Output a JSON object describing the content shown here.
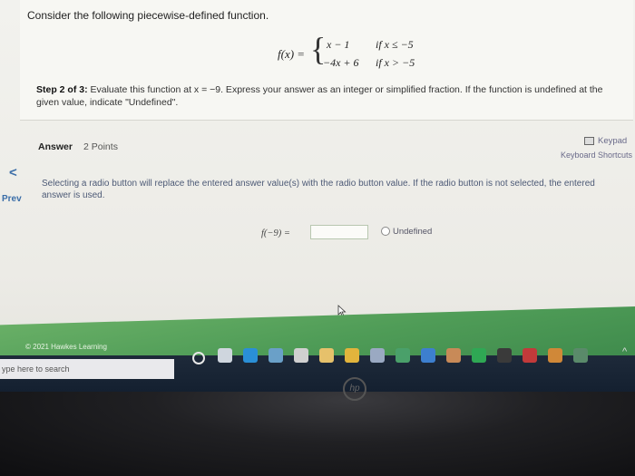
{
  "problem": {
    "question": "Consider the following piecewise-defined function.",
    "fx_label": "f(x) =",
    "brace": "{",
    "cases": [
      {
        "expr": "x − 1",
        "cond": "if x ≤ −5"
      },
      {
        "expr": "−4x + 6",
        "cond": "if x > −5"
      }
    ],
    "step_label": "Step 2 of 3:",
    "step_text": " Evaluate this function at x = −9. Express your answer as an integer or simplified fraction. If the function is undefined at the given value, indicate \"Undefined\"."
  },
  "answer": {
    "heading": "Answer",
    "points": "2 Points",
    "keypad_label": "Keypad",
    "shortcuts_label": "Keyboard Shortcuts",
    "radio_note": "Selecting a radio button will replace the entered answer value(s) with the radio button value. If the radio button is not selected, the entered answer is used.",
    "f_label": "f(−9) =",
    "input_value": "",
    "radio_label": "Undefined"
  },
  "nav": {
    "prev_chevron": "<",
    "prev_label": "Prev"
  },
  "footer": {
    "copyright": "© 2021 Hawkes Learning"
  },
  "taskbar": {
    "search_placeholder": "ype here to search",
    "icons": [
      {
        "name": "cortana-icon",
        "color": "#e8e8e8"
      },
      {
        "name": "task-view-icon",
        "color": "#cfd6de"
      },
      {
        "name": "edge-icon",
        "color": "#2a8fd6"
      },
      {
        "name": "photos-icon",
        "color": "#6aa0c8"
      },
      {
        "name": "store-icon",
        "color": "#d0d0d0"
      },
      {
        "name": "files-icon",
        "color": "#e6c16b"
      },
      {
        "name": "chrome-icon",
        "color": "#e2b43c"
      },
      {
        "name": "app-a-icon",
        "color": "#9aa9c2"
      },
      {
        "name": "media-icon",
        "color": "#4aa06a"
      },
      {
        "name": "calendar-icon",
        "color": "#3d7fcf"
      },
      {
        "name": "photo-app-icon",
        "color": "#c88a58"
      },
      {
        "name": "spotify-icon",
        "color": "#2fa854"
      },
      {
        "name": "amazon-icon",
        "color": "#3a3a3a"
      },
      {
        "name": "game-icon",
        "color": "#c23a3a"
      },
      {
        "name": "app-icon",
        "color": "#d08838"
      },
      {
        "name": "app-round-icon",
        "color": "#5a8a6a"
      }
    ],
    "tray_chevron": "^"
  },
  "device": {
    "logo": "hp"
  }
}
